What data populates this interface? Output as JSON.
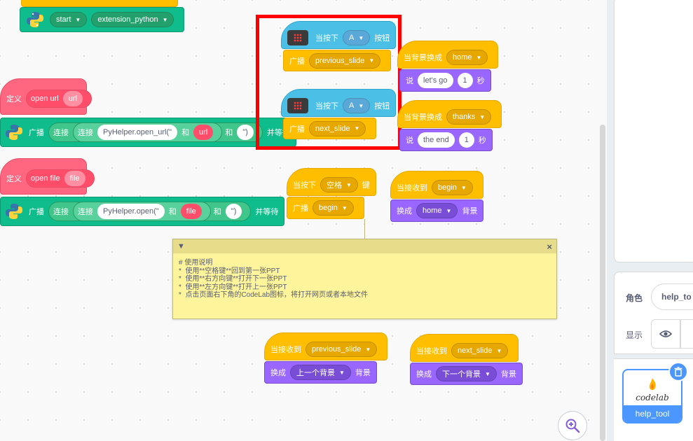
{
  "blocks": {
    "top_python": {
      "opt1": "start",
      "opt2": "extension_python"
    },
    "hat_a1": {
      "prefix": "当按下",
      "key": "A",
      "suffix": "按钮"
    },
    "bcast1": {
      "label": "广播",
      "msg": "previous_slide"
    },
    "hat_a2": {
      "prefix": "当按下",
      "key": "A",
      "suffix": "按钮"
    },
    "bcast2": {
      "label": "广播",
      "msg": "next_slide"
    },
    "bg_home": {
      "label": "当背景换成",
      "opt": "home"
    },
    "say_home": {
      "label": "说",
      "text": "let's go",
      "num": "1",
      "unit": "秒"
    },
    "bg_thanks": {
      "label": "当背景换成",
      "opt": "thanks"
    },
    "say_thanks": {
      "label": "说",
      "text": "the end",
      "num": "1",
      "unit": "秒"
    },
    "define_url": {
      "label": "定义",
      "name": "open url",
      "param": "url"
    },
    "bcast_url": {
      "label": "广播",
      "join1": "连接",
      "join2": "连接",
      "text": "PyHelper.open_url(\"",
      "param": "url",
      "and1": "和",
      "and2": "和",
      "close": "\")",
      "wait": "并等待"
    },
    "define_file": {
      "label": "定义",
      "name": "open file",
      "param": "file"
    },
    "bcast_file": {
      "label": "广播",
      "join1": "连接",
      "join2": "连接",
      "text": "PyHelper.open(\"",
      "param": "file",
      "and1": "和",
      "and2": "和",
      "close": "\")",
      "wait": "并等待"
    },
    "hat_space": {
      "prefix": "当按下",
      "key": "空格",
      "suffix": "键"
    },
    "bcast_begin": {
      "label": "广播",
      "msg": "begin"
    },
    "recv_begin": {
      "label": "当接收到",
      "msg": "begin"
    },
    "switch_home": {
      "label": "换成",
      "opt": "home",
      "suffix": "背景"
    },
    "recv_prev": {
      "label": "当接收到",
      "msg": "previous_slide"
    },
    "switch_prev": {
      "label": "换成",
      "opt": "上一个背景",
      "suffix": "背景"
    },
    "recv_next": {
      "label": "当接收到",
      "msg": "next_slide"
    },
    "switch_next": {
      "label": "换成",
      "opt": "下一个背景",
      "suffix": "背景"
    }
  },
  "comment": {
    "text": "# 使用说明\n*  使用**空格键**回到第一张PPT\n*  使用**右方向键**打开下一张PPT\n*  使用**左方向键**打开上一张PPT\n*  点击页面右下角的CodeLab图标，将打开网页或者本地文件"
  },
  "sprite": {
    "role_label": "角色",
    "name_value": "help_to",
    "show_label": "显示",
    "thumb_name": "help_tool",
    "thumb_logo": "codelab"
  },
  "icons": [
    "python-icon",
    "microbit-icon",
    "dropdown-arrow-icon",
    "close-icon",
    "collapse-icon",
    "eye-icon",
    "trash-icon",
    "zoom-in-icon"
  ],
  "colors": {
    "event": "#ffbf00",
    "looks": "#9966ff",
    "extension": "#0fbd8c",
    "define": "#ff6680",
    "microbit": "#4cbfe6",
    "highlight": "#ff0000"
  }
}
